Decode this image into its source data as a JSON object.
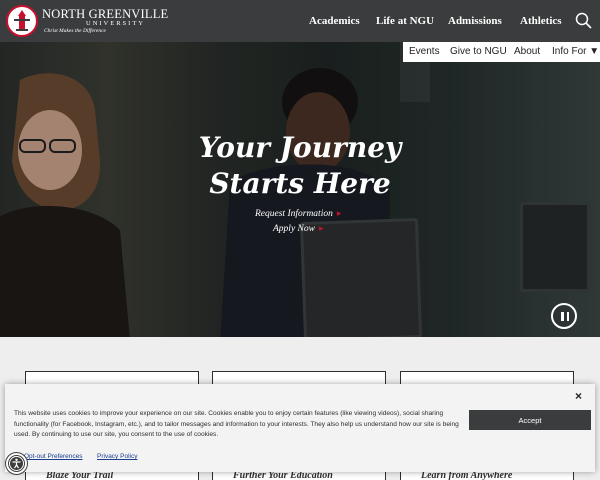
{
  "header": {
    "logo": {
      "name": "NORTH GREENVILLE",
      "sub": "UNIVERSITY",
      "tagline": "Christ Makes the Difference"
    },
    "nav": [
      "Academics",
      "Life at NGU",
      "Admissions",
      "Athletics"
    ],
    "search_icon": "search-icon"
  },
  "utility_nav": {
    "events": "Events",
    "give": "Give to NGU",
    "about": "About",
    "info_for": "Info For",
    "info_caret": "▼"
  },
  "hero": {
    "title_line1": "Your Journey",
    "title_line2": "Starts Here",
    "links": [
      {
        "label": "Request Information",
        "arrow": "▸"
      },
      {
        "label": "Apply Now",
        "arrow": "▸"
      }
    ],
    "pause_icon": "pause-icon"
  },
  "cards": [
    {
      "title": "Blaze Your Trail"
    },
    {
      "title": "Further Your Education"
    },
    {
      "title": "Learn from Anywhere"
    }
  ],
  "cookie_banner": {
    "text": "This website uses cookies to improve your experience on our site. Cookies enable you to enjoy certain features (like viewing videos), social sharing functionality (for Facebook, Instagram, etc.), and to tailor messages and information to your interests. They also help us understand how our site is being used. By continuing to use our site, you consent to the use of cookies.",
    "accept": "Accept",
    "close": "×",
    "optout": "Opt-out Preferences",
    "privacy": "Privacy Policy"
  },
  "colors": {
    "header_bg": "#3a3c3d",
    "accent_red": "#c8102e",
    "link_blue": "#1a3d8f"
  },
  "icons": [
    "university-seal-icon",
    "search-icon",
    "pause-icon",
    "accessibility-icon",
    "close-icon"
  ]
}
